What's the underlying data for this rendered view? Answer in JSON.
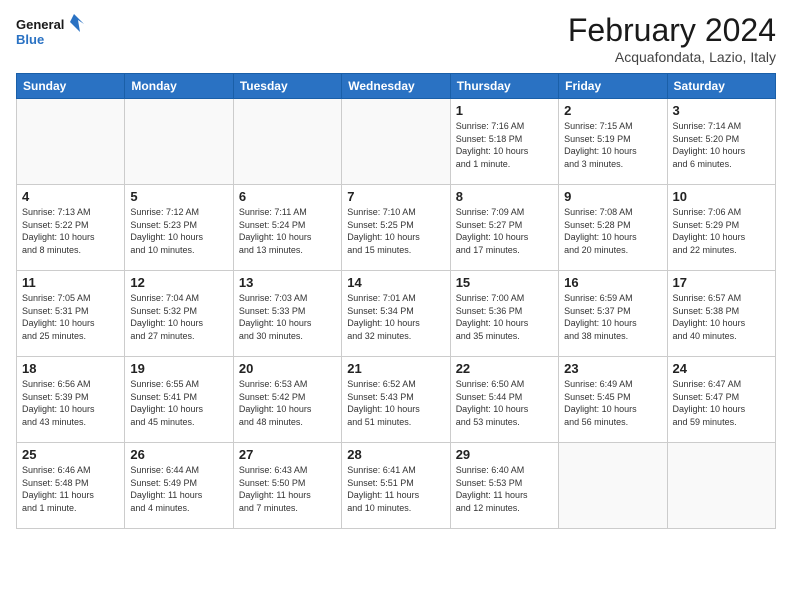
{
  "logo": {
    "line1": "General",
    "line2": "Blue"
  },
  "title": "February 2024",
  "location": "Acquafondata, Lazio, Italy",
  "days_of_week": [
    "Sunday",
    "Monday",
    "Tuesday",
    "Wednesday",
    "Thursday",
    "Friday",
    "Saturday"
  ],
  "weeks": [
    [
      {
        "day": "",
        "info": ""
      },
      {
        "day": "",
        "info": ""
      },
      {
        "day": "",
        "info": ""
      },
      {
        "day": "",
        "info": ""
      },
      {
        "day": "1",
        "info": "Sunrise: 7:16 AM\nSunset: 5:18 PM\nDaylight: 10 hours\nand 1 minute."
      },
      {
        "day": "2",
        "info": "Sunrise: 7:15 AM\nSunset: 5:19 PM\nDaylight: 10 hours\nand 3 minutes."
      },
      {
        "day": "3",
        "info": "Sunrise: 7:14 AM\nSunset: 5:20 PM\nDaylight: 10 hours\nand 6 minutes."
      }
    ],
    [
      {
        "day": "4",
        "info": "Sunrise: 7:13 AM\nSunset: 5:22 PM\nDaylight: 10 hours\nand 8 minutes."
      },
      {
        "day": "5",
        "info": "Sunrise: 7:12 AM\nSunset: 5:23 PM\nDaylight: 10 hours\nand 10 minutes."
      },
      {
        "day": "6",
        "info": "Sunrise: 7:11 AM\nSunset: 5:24 PM\nDaylight: 10 hours\nand 13 minutes."
      },
      {
        "day": "7",
        "info": "Sunrise: 7:10 AM\nSunset: 5:25 PM\nDaylight: 10 hours\nand 15 minutes."
      },
      {
        "day": "8",
        "info": "Sunrise: 7:09 AM\nSunset: 5:27 PM\nDaylight: 10 hours\nand 17 minutes."
      },
      {
        "day": "9",
        "info": "Sunrise: 7:08 AM\nSunset: 5:28 PM\nDaylight: 10 hours\nand 20 minutes."
      },
      {
        "day": "10",
        "info": "Sunrise: 7:06 AM\nSunset: 5:29 PM\nDaylight: 10 hours\nand 22 minutes."
      }
    ],
    [
      {
        "day": "11",
        "info": "Sunrise: 7:05 AM\nSunset: 5:31 PM\nDaylight: 10 hours\nand 25 minutes."
      },
      {
        "day": "12",
        "info": "Sunrise: 7:04 AM\nSunset: 5:32 PM\nDaylight: 10 hours\nand 27 minutes."
      },
      {
        "day": "13",
        "info": "Sunrise: 7:03 AM\nSunset: 5:33 PM\nDaylight: 10 hours\nand 30 minutes."
      },
      {
        "day": "14",
        "info": "Sunrise: 7:01 AM\nSunset: 5:34 PM\nDaylight: 10 hours\nand 32 minutes."
      },
      {
        "day": "15",
        "info": "Sunrise: 7:00 AM\nSunset: 5:36 PM\nDaylight: 10 hours\nand 35 minutes."
      },
      {
        "day": "16",
        "info": "Sunrise: 6:59 AM\nSunset: 5:37 PM\nDaylight: 10 hours\nand 38 minutes."
      },
      {
        "day": "17",
        "info": "Sunrise: 6:57 AM\nSunset: 5:38 PM\nDaylight: 10 hours\nand 40 minutes."
      }
    ],
    [
      {
        "day": "18",
        "info": "Sunrise: 6:56 AM\nSunset: 5:39 PM\nDaylight: 10 hours\nand 43 minutes."
      },
      {
        "day": "19",
        "info": "Sunrise: 6:55 AM\nSunset: 5:41 PM\nDaylight: 10 hours\nand 45 minutes."
      },
      {
        "day": "20",
        "info": "Sunrise: 6:53 AM\nSunset: 5:42 PM\nDaylight: 10 hours\nand 48 minutes."
      },
      {
        "day": "21",
        "info": "Sunrise: 6:52 AM\nSunset: 5:43 PM\nDaylight: 10 hours\nand 51 minutes."
      },
      {
        "day": "22",
        "info": "Sunrise: 6:50 AM\nSunset: 5:44 PM\nDaylight: 10 hours\nand 53 minutes."
      },
      {
        "day": "23",
        "info": "Sunrise: 6:49 AM\nSunset: 5:45 PM\nDaylight: 10 hours\nand 56 minutes."
      },
      {
        "day": "24",
        "info": "Sunrise: 6:47 AM\nSunset: 5:47 PM\nDaylight: 10 hours\nand 59 minutes."
      }
    ],
    [
      {
        "day": "25",
        "info": "Sunrise: 6:46 AM\nSunset: 5:48 PM\nDaylight: 11 hours\nand 1 minute."
      },
      {
        "day": "26",
        "info": "Sunrise: 6:44 AM\nSunset: 5:49 PM\nDaylight: 11 hours\nand 4 minutes."
      },
      {
        "day": "27",
        "info": "Sunrise: 6:43 AM\nSunset: 5:50 PM\nDaylight: 11 hours\nand 7 minutes."
      },
      {
        "day": "28",
        "info": "Sunrise: 6:41 AM\nSunset: 5:51 PM\nDaylight: 11 hours\nand 10 minutes."
      },
      {
        "day": "29",
        "info": "Sunrise: 6:40 AM\nSunset: 5:53 PM\nDaylight: 11 hours\nand 12 minutes."
      },
      {
        "day": "",
        "info": ""
      },
      {
        "day": "",
        "info": ""
      }
    ]
  ]
}
